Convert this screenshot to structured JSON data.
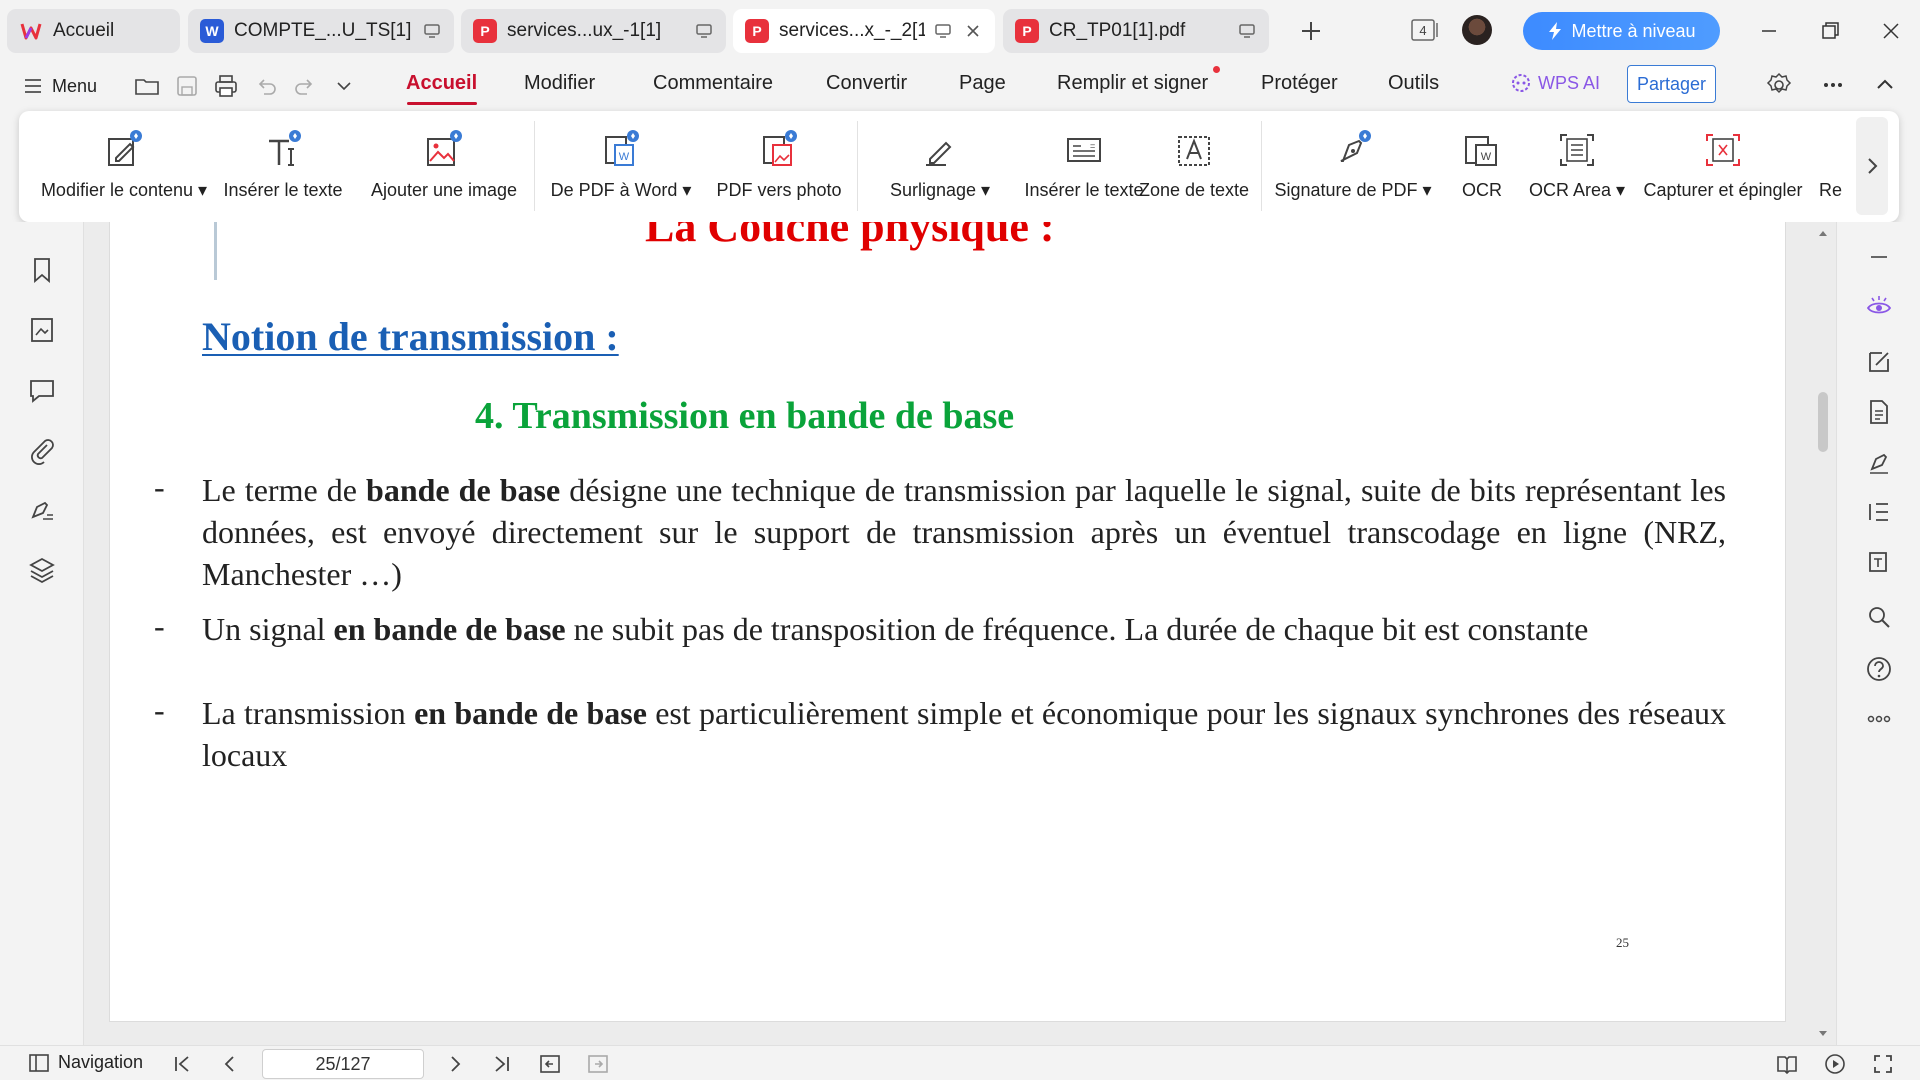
{
  "tabs": [
    {
      "label": "Accueil",
      "icon": "wps-logo-icon"
    },
    {
      "label": "COMPTE_...U_TS[1]",
      "icon": "word-doc-icon"
    },
    {
      "label": "services...ux_-1[1]",
      "icon": "pdf-doc-icon"
    },
    {
      "label": "services...x_-_2[1]",
      "icon": "pdf-doc-icon",
      "active": true
    },
    {
      "label": "CR_TP01[1].pdf",
      "icon": "pdf-doc-icon"
    }
  ],
  "titlebar": {
    "window_count": "4",
    "upgrade_label": "Mettre à niveau"
  },
  "menubar": {
    "menu_label": "Menu",
    "tabs": [
      "Accueil",
      "Modifier",
      "Commentaire",
      "Convertir",
      "Page",
      "Remplir et signer",
      "Protéger",
      "Outils"
    ],
    "active_tab": "Accueil",
    "wps_ai_label": "WPS AI",
    "share_label": "Partager"
  },
  "ribbon": {
    "buttons": [
      {
        "label": "Modifier le contenu",
        "dropdown": true
      },
      {
        "label": "Insérer le texte"
      },
      {
        "label": "Ajouter une image"
      },
      {
        "label": "De PDF à Word",
        "dropdown": true
      },
      {
        "label": "PDF vers photo"
      },
      {
        "label": "Surlignage",
        "dropdown": true
      },
      {
        "label": "Insérer le texte"
      },
      {
        "label": "Zone de texte"
      },
      {
        "label": "Signature de PDF",
        "dropdown": true
      },
      {
        "label": "OCR"
      },
      {
        "label": "OCR Area",
        "dropdown": true
      },
      {
        "label": "Capturer et épingler"
      },
      {
        "label": "Re"
      }
    ]
  },
  "document": {
    "chapter_title": "La Couche physique :",
    "section_heading": "Notion de transmission :",
    "subsection_heading": "4.  Transmission en bande de base",
    "bullet": "-",
    "paragraphs": [
      {
        "before": "Le terme de ",
        "bold": "bande de base",
        "after": " désigne une technique de transmission par laquelle le signal, suite de bits représentant les données, est envoyé directement sur le support de transmission après un éventuel transcodage en ligne (NRZ, Manchester …)"
      },
      {
        "before": "Un signal ",
        "bold": "en bande de base",
        "after": " ne subit pas de transposition de fréquence. La durée de chaque bit est constante"
      },
      {
        "before": "La transmission ",
        "bold": "en bande de base",
        "after": " est particulièrement simple et économique pour les signaux synchrones des réseaux locaux"
      }
    ],
    "page_folio": "25",
    "colors": {
      "chapter": "#e00000",
      "section": "#1a5fb4",
      "subsection": "#0aa33a"
    }
  },
  "statusbar": {
    "navigation_label": "Navigation",
    "page_indicator": "25/127"
  }
}
